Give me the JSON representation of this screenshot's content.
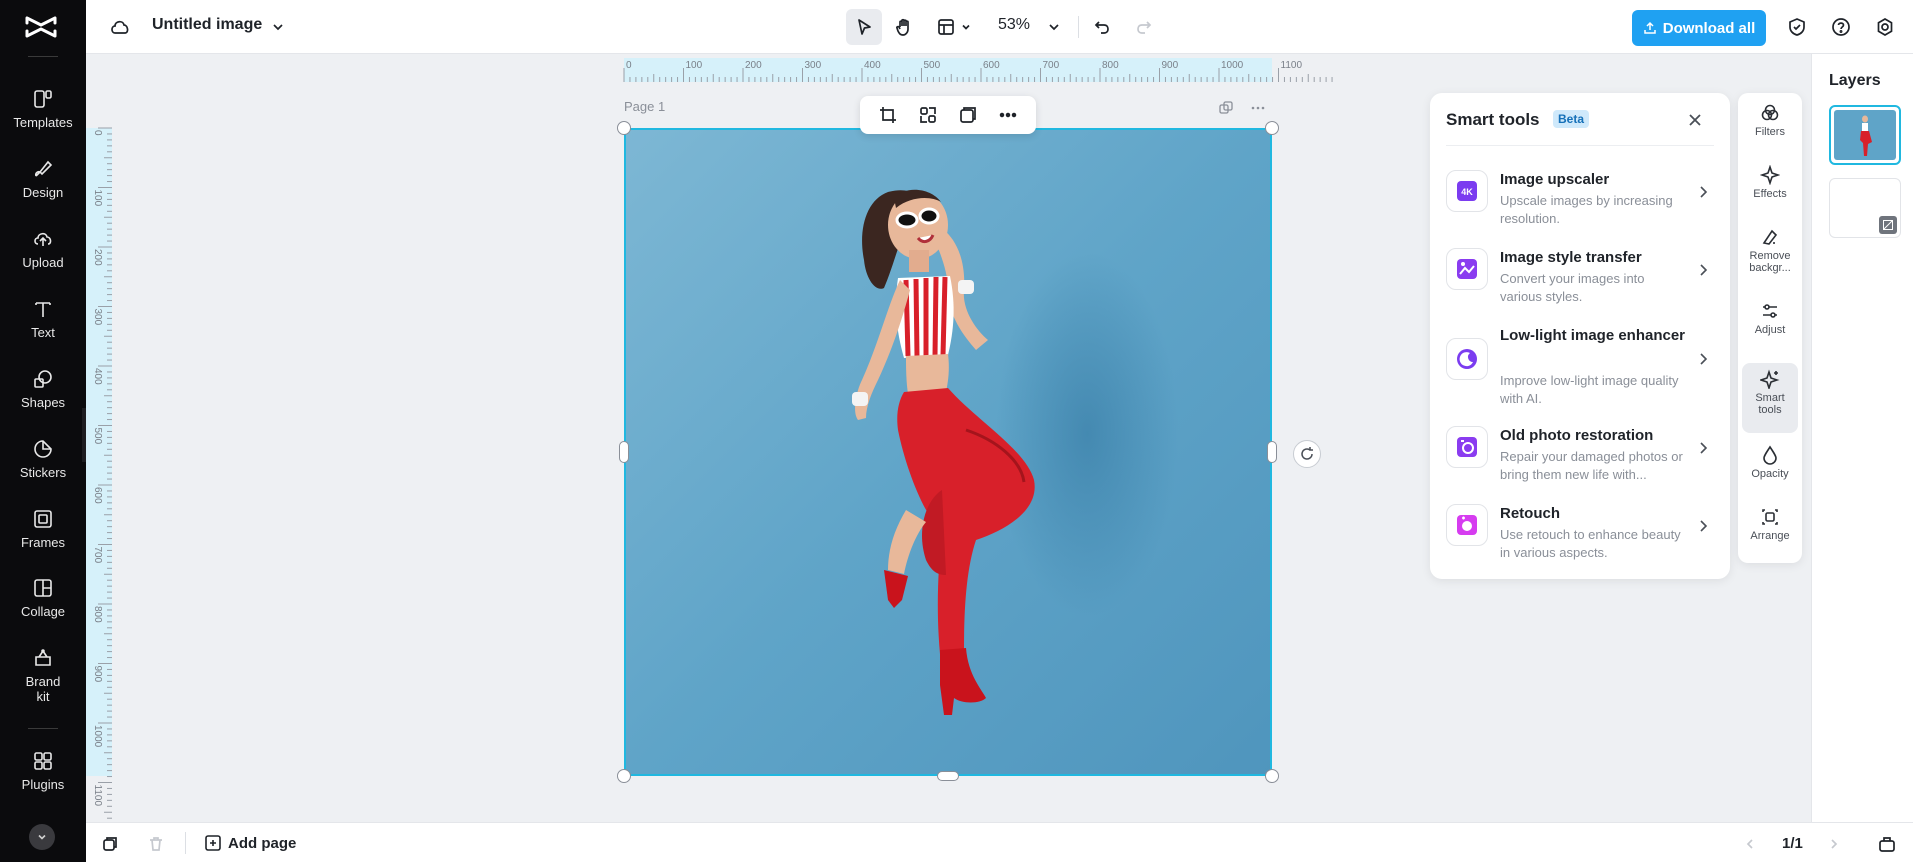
{
  "app": {
    "brand": "CapCut"
  },
  "header": {
    "doc_title": "Untitled image",
    "zoom": "53%",
    "download_label": "Download all"
  },
  "sidebar": {
    "items": [
      {
        "label": "Templates",
        "icon": "templates-icon"
      },
      {
        "label": "Design",
        "icon": "design-icon"
      },
      {
        "label": "Upload",
        "icon": "upload-icon"
      },
      {
        "label": "Text",
        "icon": "text-icon"
      },
      {
        "label": "Shapes",
        "icon": "shapes-icon"
      },
      {
        "label": "Stickers",
        "icon": "stickers-icon"
      },
      {
        "label": "Frames",
        "icon": "frames-icon"
      },
      {
        "label": "Collage",
        "icon": "collage-icon"
      },
      {
        "label": "Brand kit",
        "icon": "brand-kit-icon"
      },
      {
        "label": "Plugins",
        "icon": "plugins-icon"
      }
    ]
  },
  "rulers": {
    "top": [
      "0",
      "100",
      "200",
      "300",
      "400",
      "500",
      "600",
      "700",
      "800",
      "900",
      "1000",
      "1100"
    ],
    "left": [
      "0",
      "100",
      "200",
      "300",
      "400",
      "500",
      "600",
      "700",
      "800",
      "900",
      "1000",
      "1100"
    ]
  },
  "canvas": {
    "page_label": "Page 1"
  },
  "smart_tools": {
    "title": "Smart tools",
    "badge": "Beta",
    "tools": [
      {
        "name": "Image upscaler",
        "desc": "Upscale images by increasing resolution."
      },
      {
        "name": "Image style transfer",
        "desc": "Convert your images into various styles."
      },
      {
        "name": "Low-light image enhancer",
        "desc": "Improve low-light image quality with AI."
      },
      {
        "name": "Old photo restoration",
        "desc": "Repair your damaged photos or bring them new life with..."
      },
      {
        "name": "Retouch",
        "desc": "Use retouch to enhance beauty in various aspects."
      }
    ]
  },
  "properties": {
    "items": [
      {
        "label": "Filters"
      },
      {
        "label": "Effects"
      },
      {
        "label": "Remove backgr..."
      },
      {
        "label": "Adjust"
      },
      {
        "label": "Smart tools"
      },
      {
        "label": "Opacity"
      },
      {
        "label": "Arrange"
      }
    ]
  },
  "layers": {
    "title": "Layers"
  },
  "footer": {
    "add_page": "Add page",
    "page_count": "1/1"
  },
  "colors": {
    "accent": "#1fa1f2",
    "selection": "#20b8e0",
    "photo_background": "#5fa4c8",
    "outfit_red": "#d8202a"
  }
}
